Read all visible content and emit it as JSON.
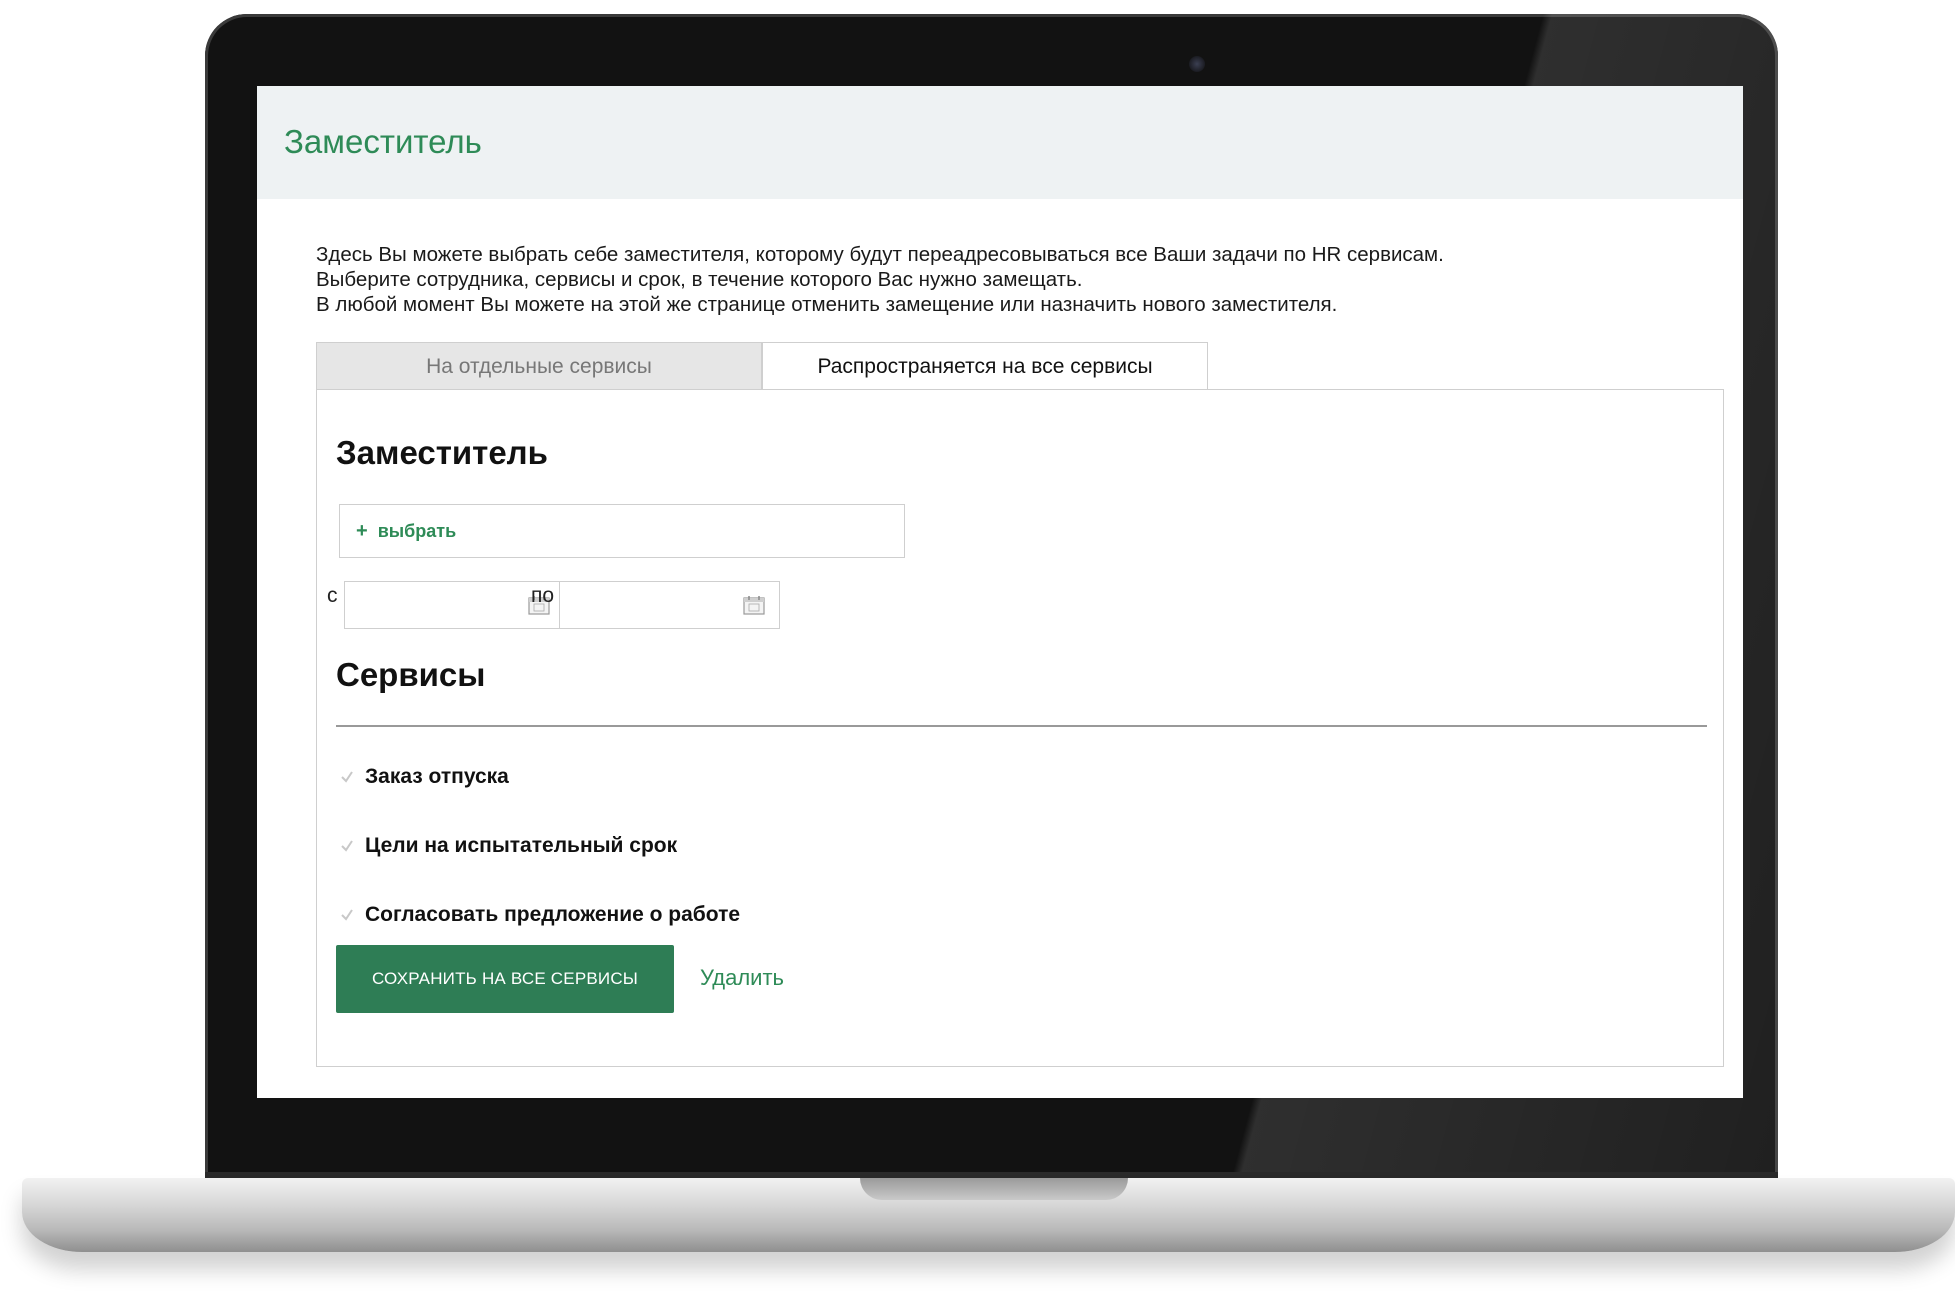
{
  "page": {
    "title": "Заместитель",
    "intro_lines": [
      "Здесь Вы можете выбрать себе заместителя, которому будут переадресовываться все Ваши задачи по HR сервисам.",
      "Выберите сотрудника, сервисы и срок, в течение которого Вас нужно замещать.",
      "В любой момент Вы можете на этой же странице отменить замещение или назначить нового заместителя."
    ]
  },
  "tabs": [
    {
      "label": "На отдельные сервисы",
      "active": false
    },
    {
      "label": "Распространяется на все сервисы",
      "active": true
    }
  ],
  "deputy": {
    "heading": "Заместитель",
    "select_plus": "+",
    "select_label": "выбрать",
    "date_from_label": "с",
    "date_to_label": "по",
    "date_from_value": "",
    "date_to_value": "",
    "calendar_icon": "calendar-icon"
  },
  "services": {
    "heading": "Сервисы",
    "items": [
      {
        "label": "Заказ отпуска",
        "checked": true
      },
      {
        "label": "Цели на испытательный срок",
        "checked": true
      },
      {
        "label": "Согласовать предложение о работе",
        "checked": true
      }
    ]
  },
  "actions": {
    "save_label": "СОХРАНИТЬ НА ВСЕ СЕРВИСЫ",
    "delete_label": "Удалить"
  },
  "colors": {
    "accent": "#2e8b57",
    "button": "#2e7d55",
    "header_bg": "#eef2f3"
  }
}
